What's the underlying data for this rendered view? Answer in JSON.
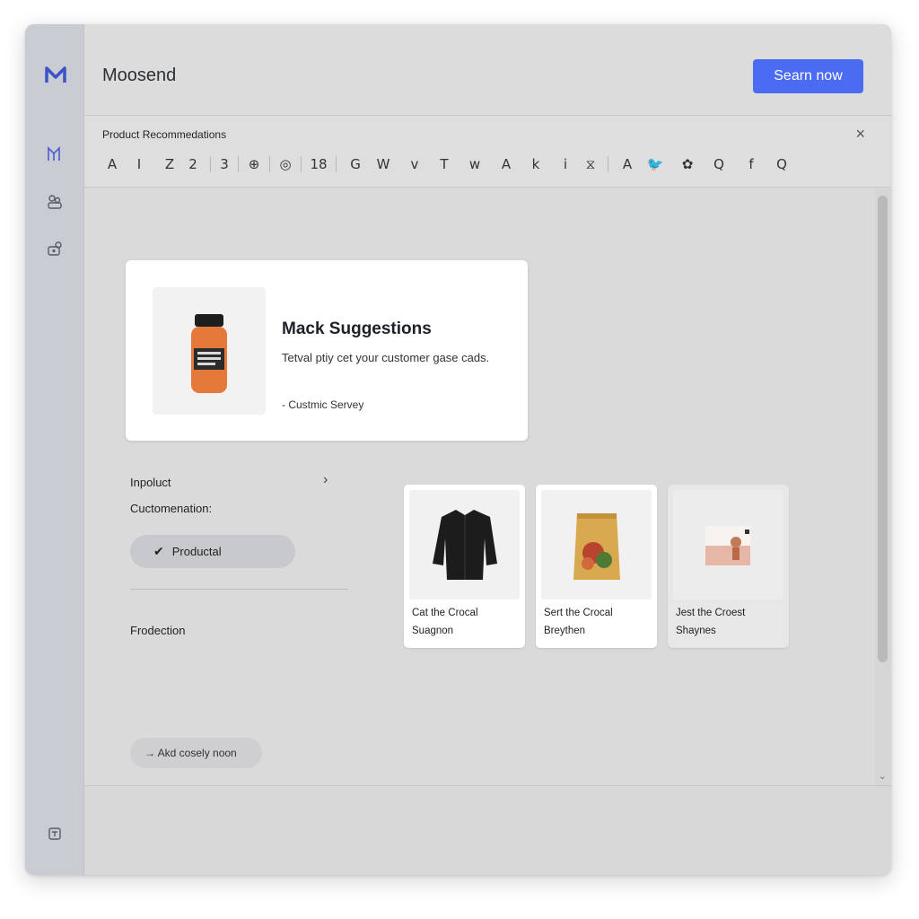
{
  "app": {
    "title": "Moosend",
    "logo_text": "M"
  },
  "header": {
    "primary_button": "Searn now"
  },
  "panel": {
    "title": "Product Recommedations",
    "close": "×"
  },
  "toolbar": {
    "tools": [
      "A",
      "I",
      "Z",
      "2",
      "3",
      "⊕",
      "◎",
      "18",
      "G",
      "W",
      "v",
      "T",
      "w",
      "A",
      "k",
      "i",
      "⧖",
      "A",
      "🐦",
      "✿",
      "Q",
      "f",
      "Q"
    ]
  },
  "hero": {
    "title": "Mack Suggestions",
    "description": "Tetval ptiy cet your customer gase cads.",
    "meta": "- Custmic Servey",
    "image_icon": "orange-bottle-icon"
  },
  "left": {
    "label1": "Inpoluct",
    "label2": "Cuctomenation:",
    "chip_label": "Productal",
    "label3": "Frodection"
  },
  "products": [
    {
      "line1": "Cat the Crocal",
      "line2": "Suagnon",
      "image_icon": "black-jacket-icon"
    },
    {
      "line1": "Sert the Crocal",
      "line2": "Breythen",
      "image_icon": "snack-bag-icon"
    },
    {
      "line1": "Jest the Croest",
      "line2": "Shaynes",
      "image_icon": "photo-card-icon"
    }
  ],
  "footer": {
    "button": "→ Akd cosely noon"
  },
  "colors": {
    "accent": "#4b6cf2",
    "logo": "#3f51c9"
  }
}
